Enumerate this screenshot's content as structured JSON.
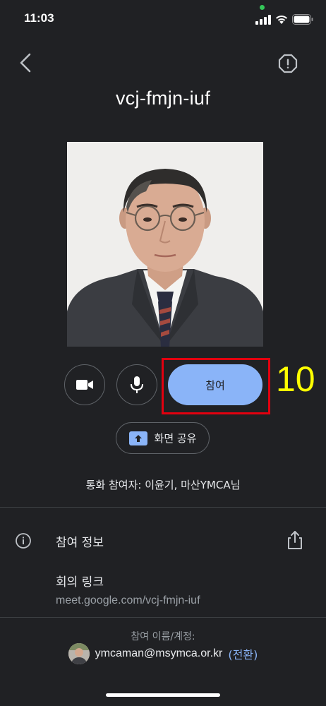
{
  "status_bar": {
    "time": "11:03"
  },
  "header": {
    "meeting_code": "vcj-fmjn-iuf"
  },
  "controls": {
    "join_label": "참여",
    "share_screen_label": "화면 공유",
    "annotation_step": "10"
  },
  "participants_text": "통화 참여자: 이윤기, 마산YMCA님",
  "info": {
    "title": "참여 정보",
    "link_label": "회의 링크",
    "link_value": "meet.google.com/vcj-fmjn-iuf"
  },
  "footer": {
    "label": "참여 이름/계정:",
    "email": "ymcaman@msymca.or.kr",
    "open_paren": "(",
    "switch_label": "전환",
    "close_paren": ")"
  },
  "colors": {
    "background": "#202124",
    "accent": "#8ab4f8",
    "highlight": "#e3000f",
    "step_number": "#ffff00"
  },
  "icons": [
    "back-arrow-icon",
    "report-problem-icon",
    "camera-icon",
    "microphone-icon",
    "present-screen-icon",
    "info-icon",
    "share-icon"
  ]
}
